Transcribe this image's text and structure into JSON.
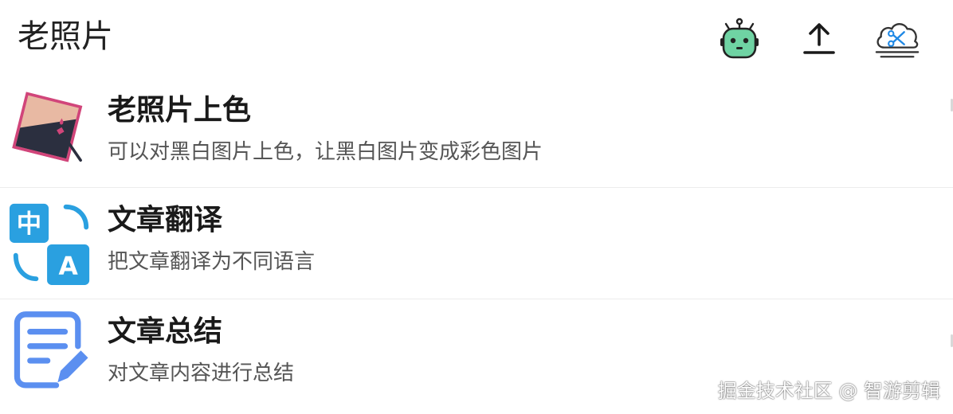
{
  "header": {
    "title": "老照片",
    "buttons": [
      {
        "icon": "robot-icon"
      },
      {
        "icon": "upload-icon"
      },
      {
        "icon": "cloud-scissors-icon"
      }
    ]
  },
  "items": [
    {
      "title": "老照片上色",
      "description": "可以对黑白图片上色，让黑白图片变成彩色图片",
      "icon": "photo-colorize-icon"
    },
    {
      "title": "文章翻译",
      "description": "把文章翻译为不同语言",
      "icon": "translate-icon"
    },
    {
      "title": "文章总结",
      "description": "对文章内容进行总结",
      "icon": "document-edit-icon"
    }
  ],
  "watermark": "掘金技术社区 @ 智游剪辑",
  "colors": {
    "robot_face": "#6fd3a3",
    "photo_pink": "#e8b9a3",
    "photo_frame": "#d1457a",
    "photo_dark": "#2b2f3f",
    "translate_blue": "#2aa0e0",
    "doc_blue": "#5b8ff0"
  }
}
